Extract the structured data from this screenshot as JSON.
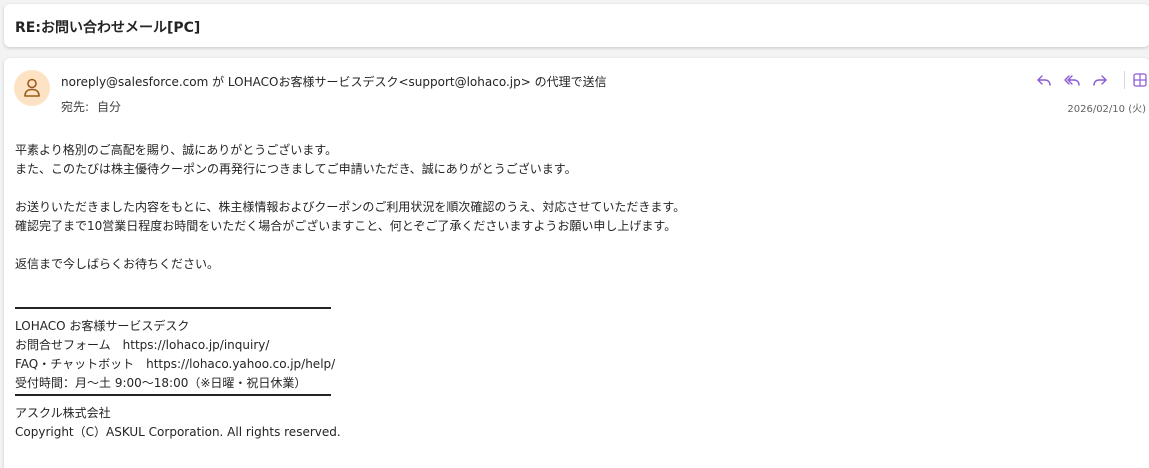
{
  "subject": "RE:お問い合わせメール[PC]",
  "sender": {
    "from_text": "noreply@salesforce.com が LOHACOお客様サービスデスク<support@lohaco.jp> の代理で送信",
    "to_label": "宛先:",
    "to_value": "自分",
    "date": "2026/02/10 (火)",
    "avatar_icon": "person-icon"
  },
  "toolbar": {
    "reply_icon": "reply-icon",
    "reply_all_icon": "reply-all-icon",
    "forward_icon": "forward-icon",
    "more_icon": "apps-icon",
    "accent": "#8a5bd6"
  },
  "body": {
    "p1_l1": "平素より格別のご高配を賜り、誠にありがとうございます。",
    "p1_l2": "また、このたびは株主優待クーポンの再発行につきましてご申請いただき、誠にありがとうございます。",
    "p2_l1": "お送りいただきました内容をもとに、株主様情報およびクーポンのご利用状況を順次確認のうえ、対応させていただきます。",
    "p2_l2": "確認完了まで10営業日程度お時間をいただく場合がございますこと、何とぞご了承くださいますようお願い申し上げます。",
    "p3_l1": "返信まで今しばらくお待ちください。"
  },
  "signature": {
    "name": "LOHACO お客様サービスデスク",
    "inquiry": "お問合せフォーム　https://lohaco.jp/inquiry/",
    "faq": "FAQ・チャットボット　https://lohaco.yahoo.co.jp/help/",
    "hours": "受付時間：月～土 9:00～18:00（※日曜・祝日休業）",
    "company": "アスクル株式会社",
    "copyright": "Copyright（C）ASKUL Corporation. All rights reserved."
  }
}
